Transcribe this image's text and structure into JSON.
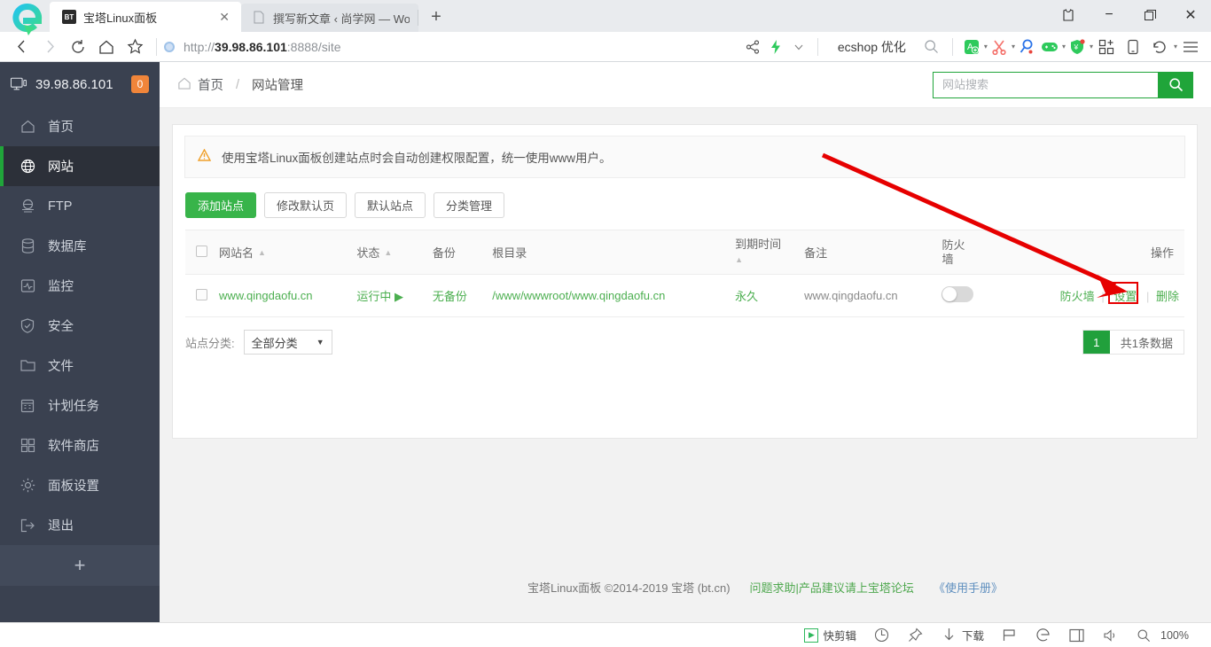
{
  "browser": {
    "tabs": [
      {
        "title": "宝塔Linux面板",
        "favicon": "bt-icon",
        "active": true,
        "close_label": "✕"
      },
      {
        "title": "撰写新文章 ‹ 尚学网 — WordPr",
        "favicon": "document-icon",
        "active": false,
        "close_label": ""
      }
    ],
    "new_tab_label": "+",
    "window_controls": {
      "shirt": "shirt-icon",
      "minimize": "−",
      "restore": "❐",
      "close": "✕"
    },
    "url": {
      "scheme": "http://",
      "host": "39.98.86.101",
      "rest": ":8888/site",
      "full": "http://39.98.86.101:8888/site"
    },
    "toolbar_search_text": "ecshop 优化",
    "nav": {
      "back": "‹",
      "forward": "›",
      "reload": "⟳",
      "home": "⌂",
      "favorite": "☆"
    }
  },
  "statusbar": {
    "quickedit_label": "快剪辑",
    "download_label": "下载",
    "zoom_label": "100%"
  },
  "sidebar": {
    "host": "39.98.86.101",
    "badge": "0",
    "items": [
      {
        "label": "首页",
        "icon": "home-icon",
        "active": false
      },
      {
        "label": "网站",
        "icon": "globe-icon",
        "active": true
      },
      {
        "label": "FTP",
        "icon": "ftp-icon",
        "active": false
      },
      {
        "label": "数据库",
        "icon": "database-icon",
        "active": false
      },
      {
        "label": "监控",
        "icon": "monitor-icon",
        "active": false
      },
      {
        "label": "安全",
        "icon": "shield-icon",
        "active": false
      },
      {
        "label": "文件",
        "icon": "folder-icon",
        "active": false
      },
      {
        "label": "计划任务",
        "icon": "calendar-icon",
        "active": false
      },
      {
        "label": "软件商店",
        "icon": "grid-icon",
        "active": false
      },
      {
        "label": "面板设置",
        "icon": "gear-icon",
        "active": false
      },
      {
        "label": "退出",
        "icon": "logout-icon",
        "active": false
      }
    ],
    "add_label": "+"
  },
  "breadcrumb": {
    "home": "首页",
    "separator": "/",
    "current": "网站管理"
  },
  "search": {
    "placeholder": "网站搜索",
    "value": "",
    "button_icon": "search-icon"
  },
  "notice": {
    "text": "使用宝塔Linux面板创建站点时会自动创建权限配置，统一使用www用户。",
    "icon": "warning-icon"
  },
  "buttons": [
    {
      "label": "添加站点",
      "style": "primary"
    },
    {
      "label": "修改默认页",
      "style": "plain"
    },
    {
      "label": "默认站点",
      "style": "plain"
    },
    {
      "label": "分类管理",
      "style": "plain"
    }
  ],
  "table": {
    "columns": [
      {
        "label": "",
        "key": "check"
      },
      {
        "label": "网站名",
        "sortable": true
      },
      {
        "label": "状态",
        "sortable": true
      },
      {
        "label": "备份",
        "sortable": false
      },
      {
        "label": "根目录",
        "sortable": false
      },
      {
        "label": "到期时间",
        "sortable": true
      },
      {
        "label": "备注",
        "sortable": false
      },
      {
        "label": "防火墙",
        "sortable": false
      },
      {
        "label": "操作",
        "sortable": false
      }
    ],
    "rows": [
      {
        "name": "www.qingdaofu.cn",
        "status": "运行中",
        "status_icon": "play-icon",
        "backup": "无备份",
        "root": "/www/wwwroot/www.qingdaofu.cn",
        "expire": "永久",
        "note": "www.qingdaofu.cn",
        "firewall_on": false,
        "ops": {
          "firewall": "防火墙",
          "settings": "设置",
          "delete": "删除",
          "sep": "|"
        }
      }
    ]
  },
  "filter": {
    "label": "站点分类:",
    "selected": "全部分类",
    "options": [
      "全部分类"
    ],
    "caret": "▼"
  },
  "pagination": {
    "current_page": "1",
    "total_text": "共1条数据"
  },
  "footer": {
    "copyright": "宝塔Linux面板 ©2014-2019 宝塔 (bt.cn)",
    "help_link": "问题求助|产品建议请上宝塔论坛",
    "manual_link": "《使用手册》"
  },
  "annotation": {
    "highlight_target": "设置",
    "arrow_color": "#e60000"
  }
}
